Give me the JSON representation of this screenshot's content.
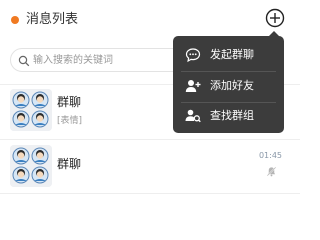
{
  "header": {
    "title": "消息列表",
    "accent_color": "#f07a22",
    "add_icon": "plus-circle-icon"
  },
  "search": {
    "placeholder": "输入搜索的关键词",
    "value": "",
    "icon": "search-icon"
  },
  "chats": [
    {
      "name": "群聊",
      "preview": "[表情]",
      "time": "",
      "avatar": "group-avatar-icon",
      "muted": false
    },
    {
      "name": "群聊",
      "preview": "",
      "time": "01:45",
      "avatar": "group-avatar-icon",
      "muted": true
    }
  ],
  "menu": {
    "items": [
      {
        "label": "发起群聊",
        "icon": "chat-bubble-icon"
      },
      {
        "label": "添加好友",
        "icon": "add-user-icon"
      },
      {
        "label": "查找群组",
        "icon": "find-group-icon"
      }
    ],
    "background": "#3c3c3c"
  }
}
